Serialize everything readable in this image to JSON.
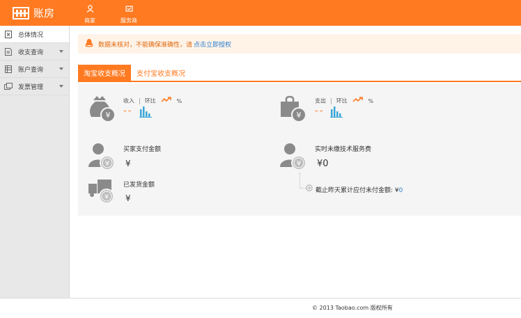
{
  "header": {
    "app_title": "账房",
    "nav": [
      {
        "label": "商家",
        "icon": "user-icon"
      },
      {
        "label": "服务商",
        "icon": "handshake-icon"
      }
    ]
  },
  "sidebar": {
    "items": [
      {
        "label": "总体情况",
        "icon": "overview-icon",
        "active": true
      },
      {
        "label": "收支查询",
        "icon": "document-icon",
        "expandable": true
      },
      {
        "label": "账户查询",
        "icon": "ledger-icon",
        "expandable": true
      },
      {
        "label": "发票管理",
        "icon": "invoice-icon",
        "expandable": true
      }
    ]
  },
  "alert": {
    "icon": "bell-icon",
    "text": "数据未核对，不能确保准确性，请",
    "link": "点击立即授权"
  },
  "tabs": [
    {
      "label": "淘宝收支概况",
      "active": true
    },
    {
      "label": "支付宝收支概况",
      "active": false
    }
  ],
  "income": {
    "label": "收入",
    "ratio_label": "环比",
    "percent": "%",
    "value": "--",
    "icon": "money-bag-icon"
  },
  "expense": {
    "label": "支出",
    "ratio_label": "环比",
    "percent": "%",
    "value": "--",
    "icon": "shopping-bag-icon"
  },
  "buyer_paid": {
    "label": "买家支付金额",
    "value": "¥",
    "icon": "buyer-yen-icon"
  },
  "shipped": {
    "label": "已发货金额",
    "value": "¥",
    "icon": "truck-icon"
  },
  "tech_fee": {
    "label": "实时未缴技术服务费",
    "value": "¥0",
    "icon": "person-yen-icon"
  },
  "accum_unpaid": {
    "label": "截止昨天累计应付未付金额:",
    "currency": "¥",
    "value": "0"
  },
  "footer": {
    "text": "© 2013 Taobao.com 版权所有"
  },
  "colors": {
    "accent": "#ff7a21",
    "link": "#2a7fd0",
    "chart_blue": "#3aa7d8"
  }
}
